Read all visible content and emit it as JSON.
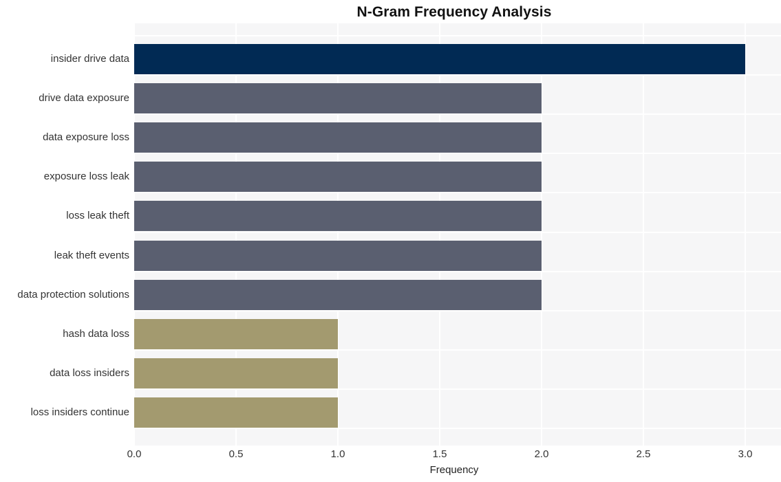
{
  "chart_data": {
    "type": "bar",
    "orientation": "horizontal",
    "title": "N-Gram Frequency Analysis",
    "xlabel": "Frequency",
    "ylabel": "",
    "categories": [
      "insider drive data",
      "drive data exposure",
      "data exposure loss",
      "exposure loss leak",
      "loss leak theft",
      "leak theft events",
      "data protection solutions",
      "hash data loss",
      "data loss insiders",
      "loss insiders continue"
    ],
    "values": [
      3,
      2,
      2,
      2,
      2,
      2,
      2,
      1,
      1,
      1
    ],
    "bar_colors": [
      "#012a54",
      "#5a5f70",
      "#5a5f70",
      "#5a5f70",
      "#5a5f70",
      "#5a5f70",
      "#5a5f70",
      "#a39a6f",
      "#a39a6f",
      "#a39a6f"
    ],
    "xlim": [
      0,
      3.1
    ],
    "xticks": [
      "0.0",
      "0.5",
      "1.0",
      "1.5",
      "2.0",
      "2.5",
      "3.0"
    ],
    "xtick_values": [
      0.0,
      0.5,
      1.0,
      1.5,
      2.0,
      2.5,
      3.0
    ],
    "grid": true,
    "grid_color": "#ffffff",
    "plot_background": "#f6f6f7",
    "figure_background": "#ffffff",
    "legend": null
  }
}
